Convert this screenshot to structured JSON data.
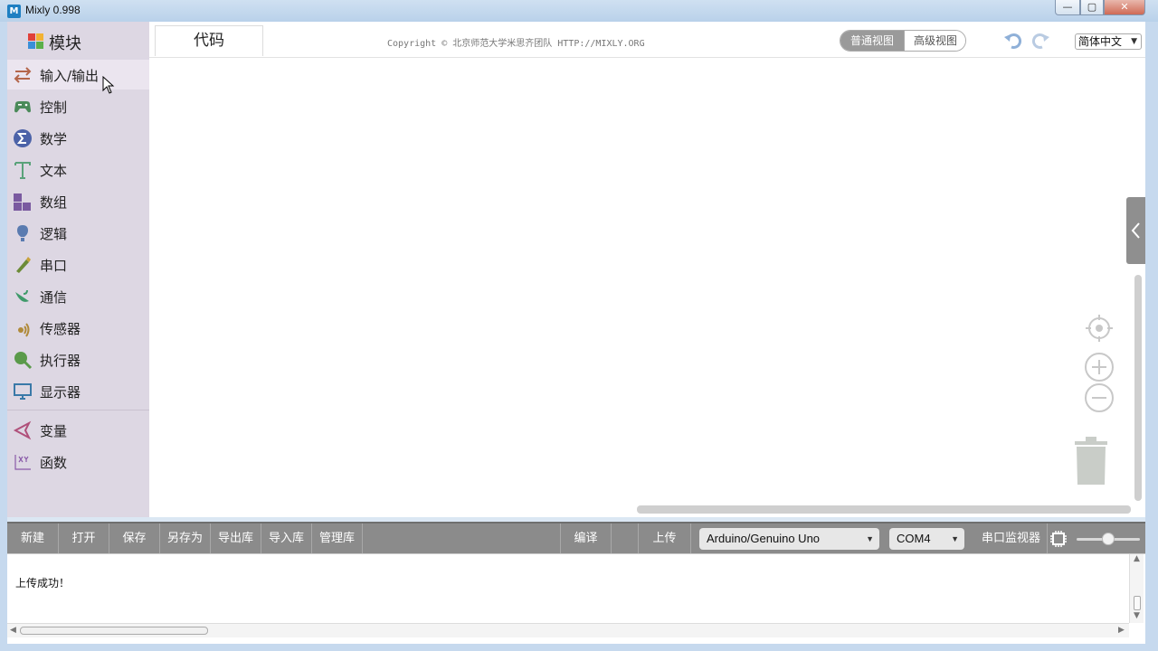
{
  "window": {
    "title": "Mixly 0.998",
    "minimize": "—",
    "maximize": "▢",
    "close": "✕"
  },
  "header": {
    "blocks_heading": "模块",
    "code_tab": "代码",
    "copyright": "Copyright © 北京师范大学米思齐团队 HTTP://MIXLY.ORG",
    "view_normal": "普通视图",
    "view_advanced": "高级视图",
    "language": "简体中文"
  },
  "sidebar": {
    "items": [
      {
        "label": "输入/输出",
        "icon": "arrows-io-icon",
        "color": "#b4654a"
      },
      {
        "label": "控制",
        "icon": "gamepad-icon",
        "color": "#4a8a59"
      },
      {
        "label": "数学",
        "icon": "sigma-icon",
        "color": "#4b62a8"
      },
      {
        "label": "文本",
        "icon": "text-t-icon",
        "color": "#5aa27a"
      },
      {
        "label": "数组",
        "icon": "blocks-array-icon",
        "color": "#7a5aa0"
      },
      {
        "label": "逻辑",
        "icon": "lightbulb-icon",
        "color": "#5a7bb0"
      },
      {
        "label": "串口",
        "icon": "pen-icon",
        "color": "#6c8b37"
      },
      {
        "label": "通信",
        "icon": "satellite-dish-icon",
        "color": "#3f9a6a"
      },
      {
        "label": "传感器",
        "icon": "sensor-icon",
        "color": "#b08a3a"
      },
      {
        "label": "执行器",
        "icon": "actuator-icon",
        "color": "#5a9a4a"
      },
      {
        "label": "显示器",
        "icon": "monitor-icon",
        "color": "#3a79a8"
      },
      {
        "label": "变量",
        "icon": "variable-cube-icon",
        "color": "#b0507a"
      },
      {
        "label": "函数",
        "icon": "function-xy-icon",
        "color": "#8a5aa8"
      }
    ]
  },
  "toolbar": {
    "new": "新建",
    "open": "打开",
    "save": "保存",
    "save_as": "另存为",
    "export_lib": "导出库",
    "import_lib": "导入库",
    "manage_lib": "管理库",
    "compile": "编译",
    "upload": "上传",
    "board": "Arduino/Genuino Uno",
    "port": "COM4",
    "serial_monitor": "串口监视器"
  },
  "console": {
    "message": "上传成功！"
  },
  "colors": {
    "sidebar_bg": "#ddd7e3",
    "toolbar_bg": "#8b8b8b",
    "accent": "#1e7fc2"
  }
}
